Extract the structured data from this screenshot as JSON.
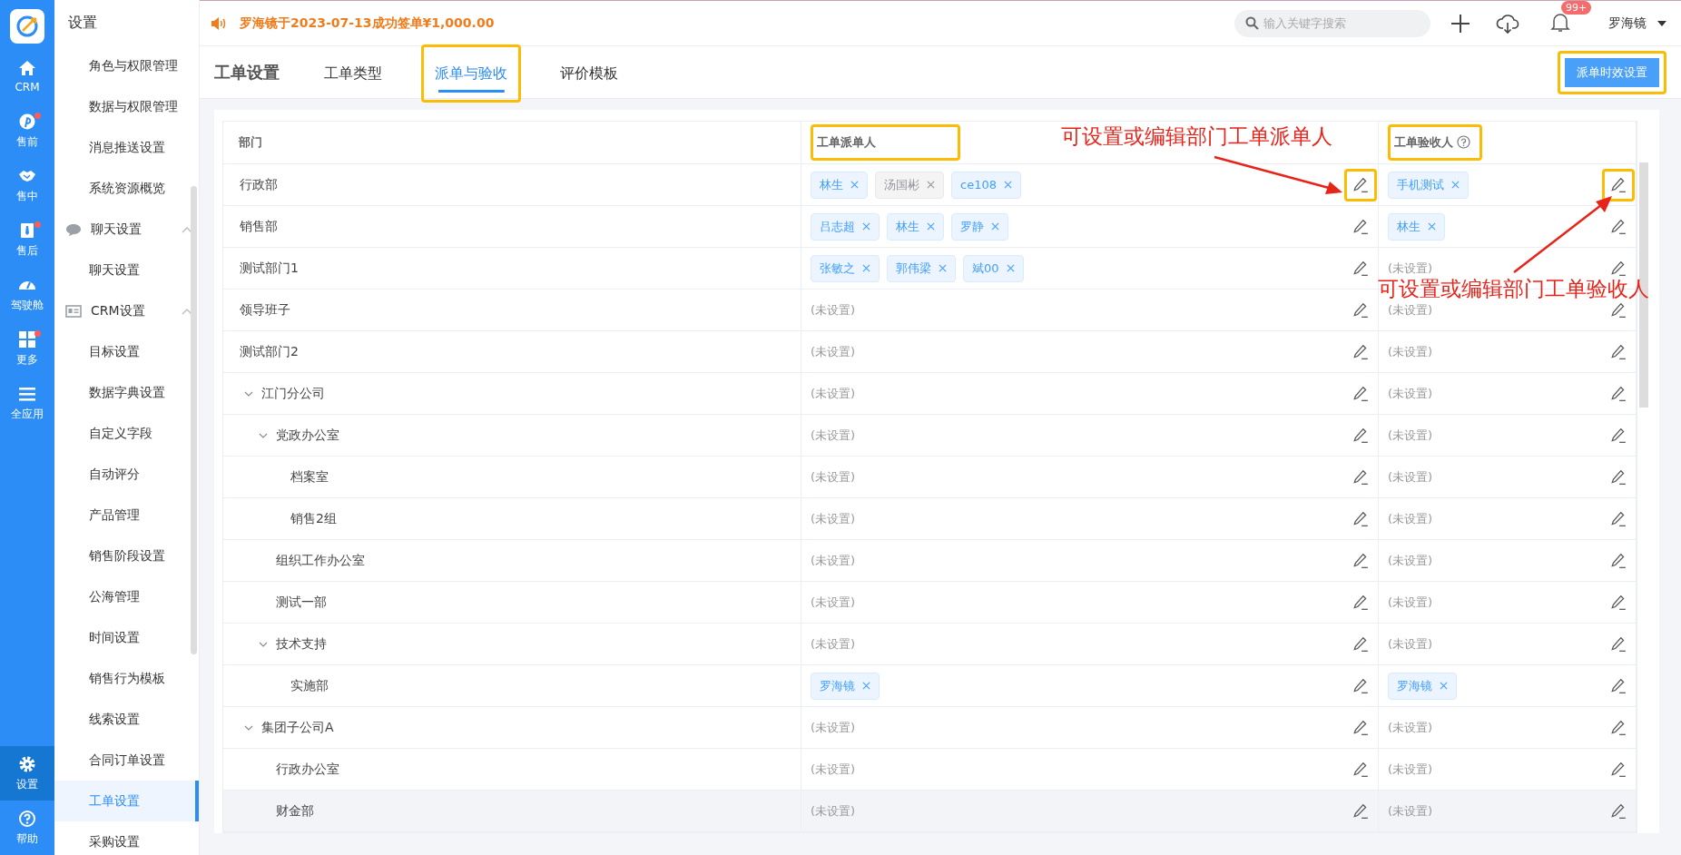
{
  "nav_rail": {
    "items": [
      {
        "label": "CRM",
        "kind": "home",
        "dot": false,
        "selected": false
      },
      {
        "label": "售前",
        "kind": "pin",
        "dot": true,
        "selected": false
      },
      {
        "label": "售中",
        "kind": "handshake",
        "dot": false,
        "selected": false
      },
      {
        "label": "售后",
        "kind": "tie",
        "dot": true,
        "selected": false
      },
      {
        "label": "驾驶舱",
        "kind": "gauge",
        "dot": false,
        "selected": false
      },
      {
        "label": "更多",
        "kind": "grid",
        "dot": true,
        "selected": false
      },
      {
        "label": "全应用",
        "kind": "menu",
        "dot": false,
        "selected": false
      }
    ],
    "bottom_items": [
      {
        "label": "设置",
        "kind": "gear",
        "dot": false,
        "selected": true
      },
      {
        "label": "帮助",
        "kind": "help",
        "dot": false,
        "selected": false
      }
    ]
  },
  "sidebar": {
    "title": "设置",
    "items": [
      {
        "label": "角色与权限管理",
        "selected": false
      },
      {
        "label": "数据与权限管理",
        "selected": false
      },
      {
        "label": "消息推送设置",
        "selected": false
      },
      {
        "label": "系统资源概览",
        "selected": false
      },
      {
        "label": "聊天设置",
        "kind": "chat",
        "expanded": true,
        "children": [
          {
            "label": "聊天设置",
            "selected": false
          }
        ]
      },
      {
        "label": "CRM设置",
        "kind": "card",
        "expanded": true,
        "children": [
          {
            "label": "目标设置",
            "selected": false
          },
          {
            "label": "数据字典设置",
            "selected": false
          },
          {
            "label": "自定义字段",
            "selected": false
          },
          {
            "label": "自动评分",
            "selected": false
          },
          {
            "label": "产品管理",
            "selected": false
          },
          {
            "label": "销售阶段设置",
            "selected": false
          },
          {
            "label": "公海管理",
            "selected": false
          },
          {
            "label": "时间设置",
            "selected": false
          },
          {
            "label": "销售行为模板",
            "selected": false
          },
          {
            "label": "线索设置",
            "selected": false
          },
          {
            "label": "合同订单设置",
            "selected": false
          },
          {
            "label": "工单设置",
            "selected": true
          },
          {
            "label": "采购设置",
            "selected": false
          }
        ]
      }
    ]
  },
  "top_bar": {
    "notice": "罗海镜于2023-07-13成功签单¥1,000.00",
    "search": {
      "placeholder": "输入关键字搜索"
    },
    "notification_badge": "99+",
    "user": "罗海镜"
  },
  "page": {
    "title": "工单设置",
    "tabs": [
      {
        "label": "工单类型",
        "selected": false,
        "marked": false
      },
      {
        "label": "派单与验收",
        "selected": true,
        "marked": true
      },
      {
        "label": "评价模板",
        "selected": false,
        "marked": false
      }
    ],
    "button": {
      "label": "派单时效设置",
      "marked": true
    }
  },
  "table": {
    "columns": [
      {
        "label": "部门",
        "marked": false,
        "help": false
      },
      {
        "label": "工单派单人",
        "marked": true,
        "help": false
      },
      {
        "label": "工单验收人",
        "marked": true,
        "help": true
      }
    ],
    "rows": [
      {
        "department": "行政部",
        "dispatchers": [
          {
            "name": "林生",
            "disabled": false
          },
          {
            "name": "汤国彬",
            "disabled": true
          },
          {
            "name": "ce108",
            "disabled": false
          }
        ],
        "acceptors": [
          {
            "name": "手机测试",
            "disabled": false
          }
        ],
        "dispatch_edit_marked": true,
        "accept_edit_marked": true,
        "hovered": false
      },
      {
        "department": "销售部",
        "dispatchers": [
          {
            "name": "吕志超",
            "disabled": false
          },
          {
            "name": "林生",
            "disabled": false
          },
          {
            "name": "罗静",
            "disabled": false
          }
        ],
        "acceptors": [
          {
            "name": "林生",
            "disabled": false
          }
        ],
        "dispatch_edit_marked": false,
        "accept_edit_marked": false,
        "hovered": false
      },
      {
        "department": "测试部门1",
        "dispatchers": [
          {
            "name": "张敏之",
            "disabled": false
          },
          {
            "name": "郭伟梁",
            "disabled": false
          },
          {
            "name": "斌00",
            "disabled": false
          }
        ],
        "accept_empty": "(未设置)",
        "dispatch_edit_marked": false,
        "accept_edit_marked": false,
        "hovered": false
      },
      {
        "department": "领导班子",
        "dispatch_empty": "(未设置)",
        "accept_empty": "(未设置)",
        "dispatch_edit_marked": false,
        "accept_edit_marked": false,
        "hovered": false
      },
      {
        "department": "测试部门2",
        "dispatch_empty": "(未设置)",
        "accept_empty": "(未设置)",
        "dispatch_edit_marked": false,
        "accept_edit_marked": false,
        "hovered": false
      },
      {
        "department": "江门分公司",
        "expanded": true,
        "dispatch_empty": "(未设置)",
        "accept_empty": "(未设置)",
        "dispatch_edit_marked": false,
        "accept_edit_marked": false,
        "hovered": false,
        "children": [
          {
            "department": "党政办公室",
            "expanded": true,
            "dispatch_empty": "(未设置)",
            "accept_empty": "(未设置)",
            "dispatch_edit_marked": false,
            "accept_edit_marked": false,
            "hovered": false,
            "children": [
              {
                "department": "档案室",
                "dispatch_empty": "(未设置)",
                "accept_empty": "(未设置)",
                "dispatch_edit_marked": false,
                "accept_edit_marked": false,
                "hovered": false
              },
              {
                "department": "销售2组",
                "dispatch_empty": "(未设置)",
                "accept_empty": "(未设置)",
                "dispatch_edit_marked": false,
                "accept_edit_marked": false,
                "hovered": false
              }
            ]
          },
          {
            "department": "组织工作办公室",
            "dispatch_empty": "(未设置)",
            "accept_empty": "(未设置)",
            "dispatch_edit_marked": false,
            "accept_edit_marked": false,
            "hovered": false
          },
          {
            "department": "测试一部",
            "dispatch_empty": "(未设置)",
            "accept_empty": "(未设置)",
            "dispatch_edit_marked": false,
            "accept_edit_marked": false,
            "hovered": false
          },
          {
            "department": "技术支持",
            "expanded": true,
            "dispatch_empty": "(未设置)",
            "accept_empty": "(未设置)",
            "dispatch_edit_marked": false,
            "accept_edit_marked": false,
            "hovered": false,
            "children": [
              {
                "department": "实施部",
                "dispatchers": [
                  {
                    "name": "罗海镜",
                    "disabled": false
                  }
                ],
                "acceptors": [
                  {
                    "name": "罗海镜",
                    "disabled": false
                  }
                ],
                "dispatch_edit_marked": false,
                "accept_edit_marked": false,
                "hovered": false
              }
            ]
          }
        ]
      },
      {
        "department": "集团子公司A",
        "expanded": true,
        "dispatch_empty": "(未设置)",
        "accept_empty": "(未设置)",
        "dispatch_edit_marked": false,
        "accept_edit_marked": false,
        "hovered": false,
        "children": [
          {
            "department": "行政办公室",
            "dispatch_empty": "(未设置)",
            "accept_empty": "(未设置)",
            "dispatch_edit_marked": false,
            "accept_edit_marked": false,
            "hovered": false
          },
          {
            "department": "财金部",
            "dispatch_empty": "(未设置)",
            "accept_empty": "(未设置)",
            "dispatch_edit_marked": false,
            "accept_edit_marked": false,
            "hovered": true
          }
        ]
      }
    ]
  },
  "annotations": [
    {
      "text": "可设置或编辑部门工单派单人",
      "kind": "dispatch"
    },
    {
      "text": "可设置或编辑部门工单验收人",
      "kind": "accept"
    }
  ]
}
